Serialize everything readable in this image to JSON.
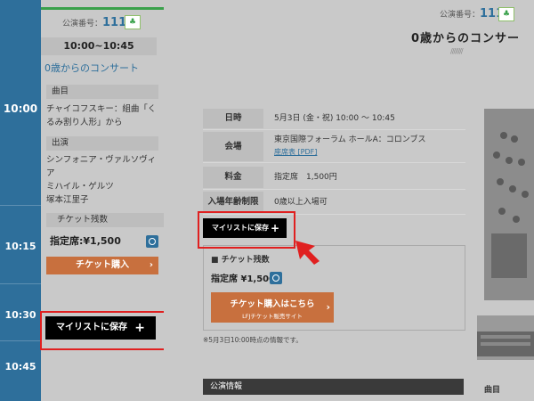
{
  "timeline": {
    "times": [
      "10:00",
      "10:15",
      "10:30",
      "10:45"
    ]
  },
  "left_panel": {
    "perf_label": "公演番号：",
    "perf_number": "111",
    "time_range": "10:00~10:45",
    "title": "0歳からのコンサート",
    "program_heading": "曲目",
    "program_lines": [
      "チャイコフスキー：組曲「く",
      "るみ割り人形」から"
    ],
    "performers_heading": "出演",
    "performers": [
      "シンフォニア・ヴァルソヴィ",
      "ア",
      "ミハイル・ゲルツ",
      "塚本江里子"
    ],
    "tickets_heading": "チケット残数",
    "price_text": "指定席:¥1,500",
    "buy_label": "チケット購入",
    "save_label": "マイリストに保存",
    "save_plus": "+"
  },
  "right_panel": {
    "perf_label": "公演番号：",
    "perf_number": "111",
    "title": "0歳からのコンサー",
    "info_rows": [
      {
        "key": "日時",
        "value": "5月3日 (金・祝) 10:00 〜 10:45"
      },
      {
        "key": "会場",
        "value": "東京国際フォーラム ホールA：コロンブス"
      },
      {
        "key": "料金",
        "value": "指定席　1,500円"
      },
      {
        "key": "入場年齢制限",
        "value": "0歳以上入場可"
      }
    ],
    "seat_chart_link": "座席表 [PDF]",
    "save_label": "マイリストに保存",
    "save_plus": "+",
    "tickets_heading": "■ チケット残数",
    "price_text": "指定席 ¥1,500",
    "buy_label": "チケット購入はこちら",
    "buy_sub": "LFJチケット販売サイト",
    "note": "※5月3日10:00時点の情報です。",
    "info_bar": "公演情報",
    "program_bar": "曲目"
  },
  "colors": {
    "timeline": "#2e6f9b",
    "highlight": "#e02020",
    "buy": "#c8703e",
    "green": "#3aa14b"
  }
}
